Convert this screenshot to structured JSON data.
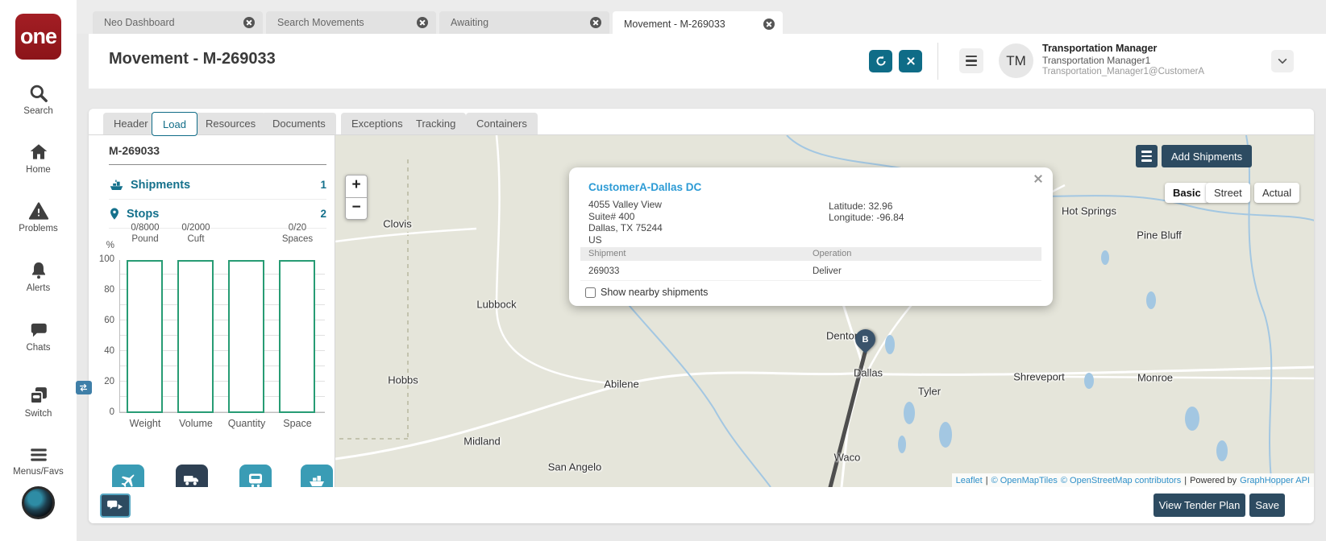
{
  "brand": {
    "logo_text": "one"
  },
  "sidebar": {
    "items": [
      {
        "label": "Search"
      },
      {
        "label": "Home"
      },
      {
        "label": "Problems"
      },
      {
        "label": "Alerts"
      },
      {
        "label": "Chats"
      },
      {
        "label": "Switch"
      },
      {
        "label": "Menus/Favs"
      }
    ]
  },
  "browser_tabs": [
    {
      "label": "Neo Dashboard",
      "active": false
    },
    {
      "label": "Search Movements",
      "active": false
    },
    {
      "label": "Awaiting",
      "active": false
    },
    {
      "label": "Movement - M-269033",
      "active": true
    }
  ],
  "header": {
    "title": "Movement - M-269033",
    "user": {
      "initials": "TM",
      "role": "Transportation Manager",
      "name": "Transportation Manager1",
      "account": "Transportation_Manager1@CustomerA"
    }
  },
  "subtabs": [
    {
      "label": "Header"
    },
    {
      "label": "Load"
    },
    {
      "label": "Resources"
    },
    {
      "label": "Documents"
    },
    {
      "label": "Exceptions"
    },
    {
      "label": "Tracking"
    },
    {
      "label": "Containers"
    }
  ],
  "load_panel": {
    "movement_id": "M-269033",
    "shipments_label": "Shipments",
    "shipments_count": "1",
    "stops_label": "Stops",
    "stops_count": "2"
  },
  "chart_data": {
    "type": "bar",
    "categories": [
      "Weight",
      "Volume",
      "Quantity",
      "Space"
    ],
    "values": [
      0,
      0,
      0,
      0
    ],
    "capacity_labels": [
      "0/8000\nPound",
      "0/2000\nCuft",
      "",
      "0/20\nSpaces"
    ],
    "ylabel": "%",
    "yticks": [
      "100",
      "80",
      "60",
      "40",
      "20",
      "0"
    ],
    "ylim": [
      0,
      100
    ],
    "grid": true,
    "bar_outline_color": "#279c74",
    "note": "Capacity utilization bars all at 0% (empty outlines)"
  },
  "map": {
    "add_shipments_label": "Add Shipments",
    "zoom_in": "+",
    "zoom_out": "−",
    "layers": [
      {
        "label": "Basic",
        "active": true
      },
      {
        "label": "Street",
        "active": false
      },
      {
        "label": "Actual",
        "active": false
      }
    ],
    "marker_label": "B",
    "cities": [
      "Clovis",
      "Lubbock",
      "Hobbs",
      "Midland",
      "San Angelo",
      "Abilene",
      "Denton",
      "Dallas",
      "Waco",
      "Tyler",
      "Shreveport",
      "Monroe",
      "Hot Springs",
      "Pine Bluff"
    ],
    "popup": {
      "title": "CustomerA-Dallas DC",
      "address_lines": [
        "4055 Valley View",
        "Suite# 400",
        "Dallas, TX 75244",
        "US"
      ],
      "latitude": "Latitude: 32.96",
      "longitude": "Longitude: -96.84",
      "table": {
        "headers": [
          "Shipment",
          "Operation"
        ],
        "rows": [
          [
            "269033",
            "Deliver"
          ]
        ]
      },
      "checkbox_label": "Show nearby shipments"
    },
    "attribution": {
      "leaflet": "Leaflet",
      "sep": "|",
      "openmaptiles": "© OpenMapTiles",
      "osm": "© OpenStreetMap contributors",
      "powered_by": "Powered by",
      "graphhopper": "GraphHopper API"
    }
  },
  "footer": {
    "view_tender_plan": "View Tender Plan",
    "save": "Save"
  },
  "colors": {
    "accent_teal": "#0f6c87",
    "panel_teal": "#15718c",
    "navy_button": "#2d4b61",
    "chart_green": "#279c74",
    "brand_red": "#9e1c22",
    "map_land": "#e5e5da",
    "map_water": "#a3c7e2",
    "link_blue": "#2d9bd5",
    "pin_navy": "#3a536b"
  }
}
